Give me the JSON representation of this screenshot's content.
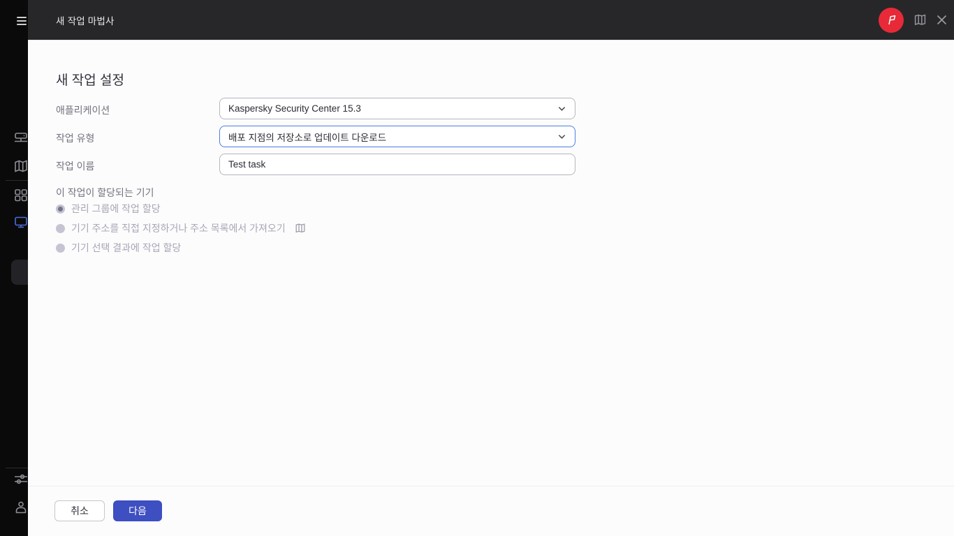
{
  "header": {
    "title": "새 작업 마법사",
    "icons": [
      "whats-new-flag-icon",
      "help-book-icon",
      "close-icon"
    ]
  },
  "sidebar": {
    "icons": [
      "menu-icon",
      "kaspersky-logo-icon",
      "server-hierarchy-icon",
      "map-icon",
      "apps-grid-icon",
      "devices-monitor-icon",
      "settings-sliders-icon",
      "user-icon"
    ],
    "active_icon": "devices-monitor-icon"
  },
  "form": {
    "title": "새 작업 설정",
    "fields": {
      "application": {
        "label": "애플리케이션",
        "value": "Kaspersky Security Center 15.3"
      },
      "task_type": {
        "label": "작업 유형",
        "value": "배포 지점의 저장소로 업데이트 다운로드",
        "focused": true
      },
      "task_name": {
        "label": "작업 이름",
        "value": "Test task"
      }
    },
    "devices_section": {
      "label": "이 작업이 할당되는 기기",
      "options": [
        {
          "label": "관리 그룹에 작업 할당",
          "selected": true,
          "disabled": true
        },
        {
          "label": "기기 주소를 직접 지정하거나 주소 목록에서 가져오기",
          "selected": false,
          "disabled": true,
          "trailing_icon": "address-book-icon"
        },
        {
          "label": "기기 선택 결과에 작업 할당",
          "selected": false,
          "disabled": true
        }
      ]
    }
  },
  "footer": {
    "cancel_label": "취소",
    "next_label": "다음"
  },
  "colors": {
    "brand_red": "#e82a38",
    "accent_blue": "#3e4fc2",
    "focus_border": "#4f7de2",
    "active_icon_blue": "#4a6ed8",
    "logo_teal": "#1fa28d",
    "header_bg": "#27272a",
    "sidebar_bg": "#0a0a0b"
  }
}
